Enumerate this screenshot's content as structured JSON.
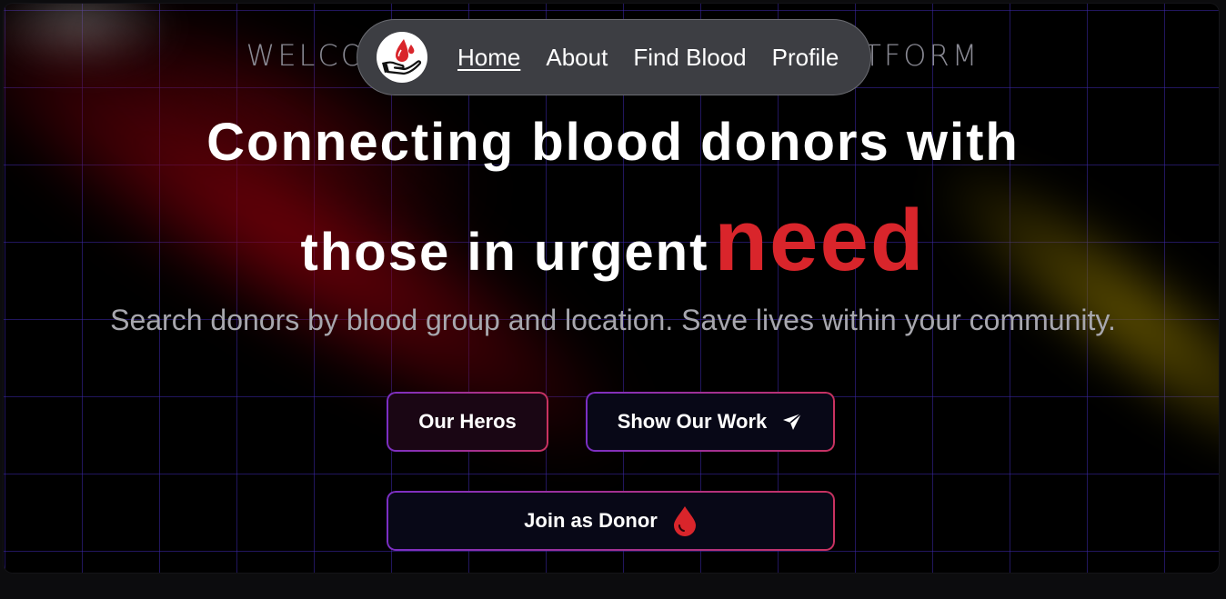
{
  "hero": {
    "eyebrow": "WELCOME TO BLOOD DONATION PLATFORM",
    "headline_line1": "Connecting blood donors with",
    "headline_line2": "those in urgent",
    "headline_accent": "need",
    "subtitle": "Search donors by blood group and location. Save lives within your community."
  },
  "nav": {
    "logo_icon": "blood-donation-hand-icon",
    "items": [
      {
        "label": "Home",
        "active": true
      },
      {
        "label": "About",
        "active": false
      },
      {
        "label": "Find Blood",
        "active": false
      },
      {
        "label": "Profile",
        "active": false
      }
    ]
  },
  "buttons": {
    "heros_label": "Our Heros",
    "work_label": "Show Our Work",
    "work_icon": "send-icon",
    "join_label": "Join as Donor",
    "join_icon": "blood-drop-icon"
  },
  "colors": {
    "accent": "#d9252b",
    "navbar_bg": "#3d3e43",
    "button_bg": "#080817",
    "button_border_start": "#7b2fc4",
    "button_border_end": "#c93260"
  }
}
